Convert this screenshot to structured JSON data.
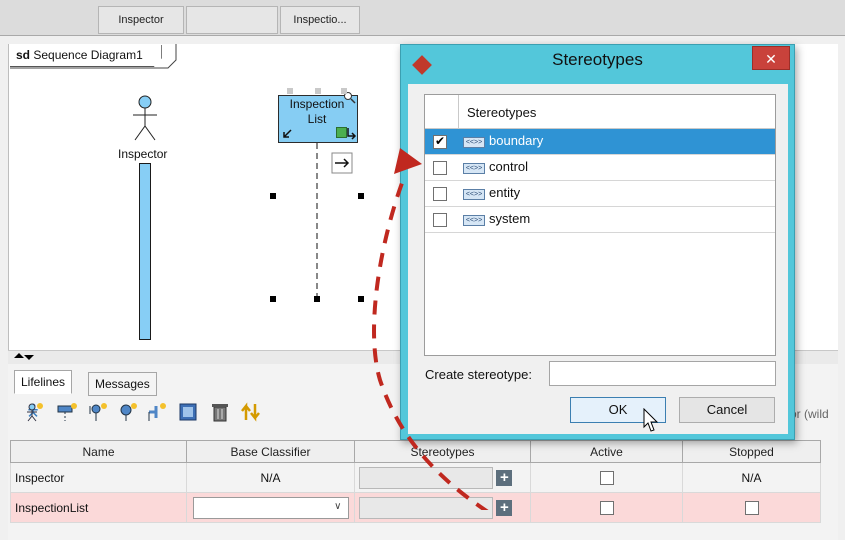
{
  "top_headers": [
    "Inspector",
    "Inspectio..."
  ],
  "diagram": {
    "tab_prefix": "sd",
    "tab_name": "Sequence Diagram1",
    "actor_label": "Inspector",
    "lifeline_label_line1": "Inspection",
    "lifeline_label_line2": "List"
  },
  "panel": {
    "tabs": [
      "Lifelines",
      "Messages"
    ],
    "filter_placeholder": "or (wild",
    "columns": [
      "Name",
      "Base Classifier",
      "Stereotypes",
      "Active",
      "Stopped"
    ],
    "rows": [
      {
        "name": "Inspector",
        "base_classifier": "N/A",
        "stopped": "N/A"
      },
      {
        "name": "InspectionList",
        "base_classifier": "",
        "stopped": ""
      }
    ]
  },
  "dialog": {
    "title": "Stereotypes",
    "close_label": "✕",
    "list_header": "Stereotypes",
    "items": [
      {
        "label": "boundary",
        "checked": true
      },
      {
        "label": "control",
        "checked": false
      },
      {
        "label": "entity",
        "checked": false
      },
      {
        "label": "system",
        "checked": false
      }
    ],
    "stereotype_icon_text": "<<>>",
    "create_label": "Create stereotype:",
    "ok_label": "OK",
    "cancel_label": "Cancel"
  },
  "colors": {
    "dialog_frame": "#53c7da",
    "selection": "#2f93d4",
    "lifeline_fill": "#86cdf3",
    "annotation_arrow": "#c0281f",
    "selected_row": "#fbd9d9"
  }
}
